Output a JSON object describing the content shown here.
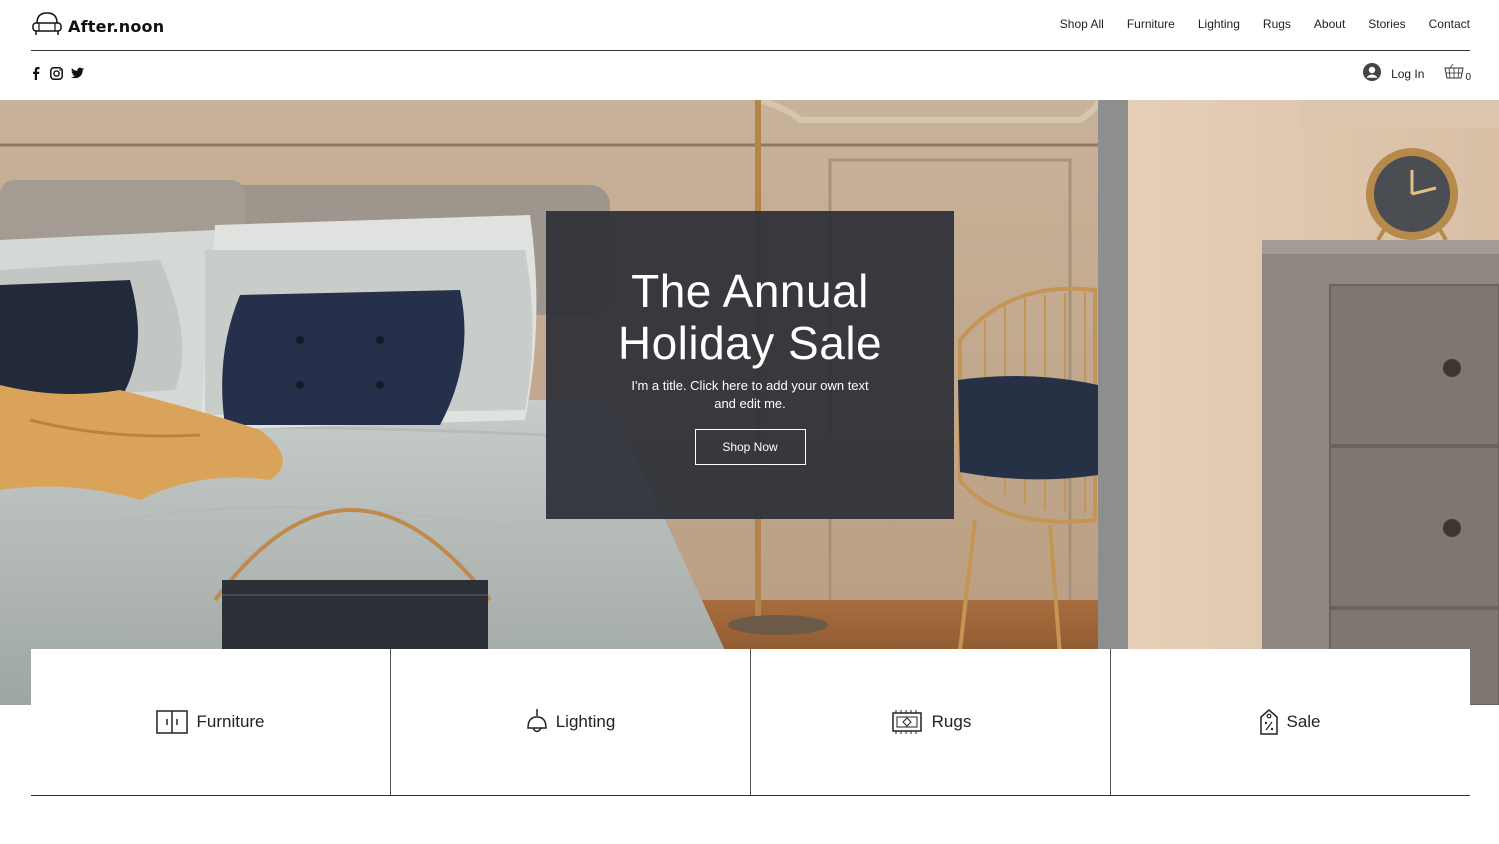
{
  "brand": {
    "name": "After.noon",
    "logo_icon": "sofa-icon"
  },
  "nav": {
    "items": [
      {
        "label": "Shop All"
      },
      {
        "label": "Furniture"
      },
      {
        "label": "Lighting"
      },
      {
        "label": "Rugs"
      },
      {
        "label": "About"
      },
      {
        "label": "Stories"
      },
      {
        "label": "Contact"
      }
    ]
  },
  "social": {
    "icons": [
      "facebook-icon",
      "instagram-icon",
      "twitter-icon"
    ]
  },
  "account": {
    "login_label": "Log In",
    "cart_count": "0"
  },
  "hero": {
    "title_line1": "The Annual",
    "title_line2": "Holiday Sale",
    "subtitle": "I'm a title. Click here to add your own text and edit me.",
    "cta_label": "Shop Now"
  },
  "categories": [
    {
      "label": "Furniture",
      "icon": "cabinet-icon"
    },
    {
      "label": "Lighting",
      "icon": "pendant-lamp-icon"
    },
    {
      "label": "Rugs",
      "icon": "rug-icon"
    },
    {
      "label": "Sale",
      "icon": "price-tag-icon"
    }
  ],
  "colors": {
    "overlay": "#2f3138",
    "divider": "#333333",
    "text": "#222222"
  }
}
